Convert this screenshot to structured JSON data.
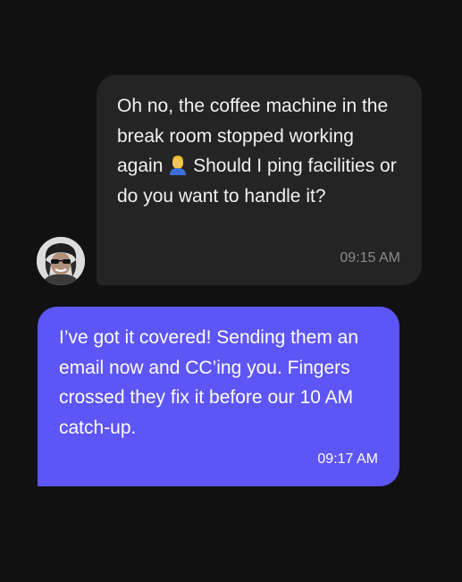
{
  "colors": {
    "background": "#111111",
    "incoming_bubble": "#242424",
    "outgoing_bubble": "#5d55f6",
    "incoming_text": "#f1f1f1",
    "incoming_time": "#8a8a8a",
    "outgoing_text": "#ffffff"
  },
  "messages": [
    {
      "direction": "incoming",
      "text_before_emoji": "Oh no, the coffee machine in the break room stopped working again",
      "emoji": "man-facepalming-emoji",
      "text_after_emoji": " Should I ping facilities or do you want to handle it?",
      "time": "09:15 AM",
      "avatar_icon": "user-avatar"
    },
    {
      "direction": "outgoing",
      "text": "I’ve got it covered! Sending them an email now and CC’ing you. Fingers crossed they fix it before our 10 AM catch-up.",
      "time": "09:17 AM"
    }
  ]
}
